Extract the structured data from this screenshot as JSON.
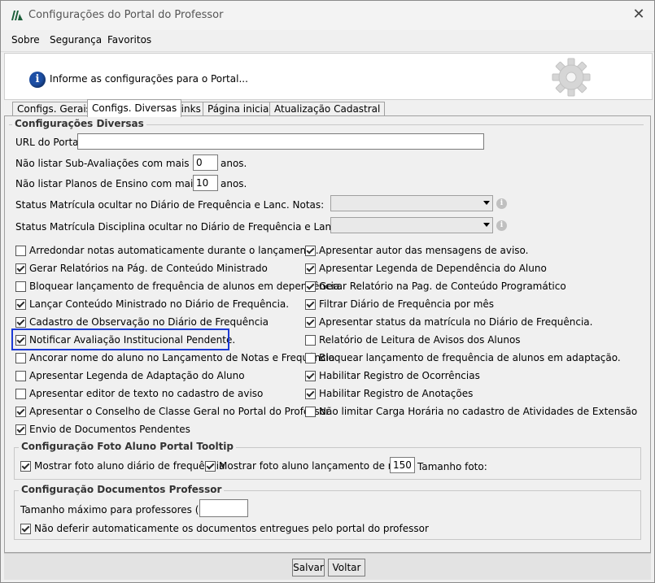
{
  "window": {
    "title": "Configurações do Portal do Professor"
  },
  "menu": [
    "Sobre",
    "Segurança",
    "Favoritos"
  ],
  "info": {
    "text": "Informe as configurações para o Portal..."
  },
  "tabs": [
    "Configs. Gerais",
    "Configs. Diversas",
    "Links",
    "Página inicial",
    "Atualização Cadastral"
  ],
  "active_tab": "Configs. Diversas",
  "diversas": {
    "legend": "Configurações Diversas",
    "url_label": "URL do Portal:",
    "url_value": "",
    "sub_label": "Não listar Sub-Avaliações com mais de:",
    "sub_value": "0",
    "sub_unit": "anos.",
    "planos_label": "Não listar Planos de Ensino com mais de:",
    "planos_value": "10",
    "planos_unit": "anos.",
    "status1_label": "Status Matrícula ocultar no Diário de Frequência e Lanc. Notas:",
    "status2_label": "Status Matrícula Disciplina ocultar no Diário de Frequência e Lanc. Notas:",
    "left_checks": [
      {
        "label": "Arredondar notas automaticamente durante o lançamento.",
        "checked": false
      },
      {
        "label": "Gerar Relatórios na Pág. de Conteúdo Ministrado",
        "checked": true
      },
      {
        "label": "Bloquear lançamento de frequência de alunos em dependência.",
        "checked": false
      },
      {
        "label": "Lançar Conteúdo Ministrado no Diário de Frequência.",
        "checked": true
      },
      {
        "label": "Cadastro de Observação no Diário de Frequência",
        "checked": true
      },
      {
        "label": "Notificar Avaliação Institucional Pendente.",
        "checked": true
      },
      {
        "label": "Ancorar nome do aluno no Lançamento de Notas e Frequência",
        "checked": false
      },
      {
        "label": "Apresentar Legenda de Adaptação do Aluno",
        "checked": false
      },
      {
        "label": "Apresentar editor de texto no cadastro de aviso",
        "checked": false
      },
      {
        "label": "Apresentar o Conselho de Classe Geral no Portal do Professor",
        "checked": true
      },
      {
        "label": "Envio de Documentos Pendentes",
        "checked": true
      }
    ],
    "right_checks": [
      {
        "label": "Apresentar autor das mensagens de aviso.",
        "checked": true
      },
      {
        "label": "Apresentar Legenda de Dependência do Aluno",
        "checked": true
      },
      {
        "label": "Gerar Relatório na Pag. de Conteúdo Programático",
        "checked": true
      },
      {
        "label": "Filtrar Diário de Frequência por mês",
        "checked": true
      },
      {
        "label": "Apresentar status da matrícula no Diário de Frequência.",
        "checked": true
      },
      {
        "label": "Relatório de Leitura de Avisos dos Alunos",
        "checked": false
      },
      {
        "label": "Bloquear lançamento de frequência de alunos em adaptação.",
        "checked": false
      },
      {
        "label": "Habilitar Registro de Ocorrências",
        "checked": true
      },
      {
        "label": "Habilitar Registro de Anotações",
        "checked": true
      },
      {
        "label": "Não limitar Carga Horária no cadastro de Atividades de Extensão",
        "checked": false
      }
    ]
  },
  "foto": {
    "legend": "Configuração Foto Aluno Portal Tooltip",
    "check1": {
      "label": "Mostrar foto aluno diário de frequência",
      "checked": true
    },
    "check2": {
      "label": "Mostrar foto aluno lançamento de nota",
      "checked": true
    },
    "size_value": "150",
    "size_label": "Tamanho foto:"
  },
  "docs": {
    "legend": "Configuração Documentos Professor",
    "max_label": "Tamanho máximo para professores (MB):",
    "max_value": "",
    "check": {
      "label": "Não deferir automaticamente os documentos entregues pelo portal do professor",
      "checked": true
    }
  },
  "footer": {
    "save": "Salvar",
    "back": "Voltar"
  }
}
